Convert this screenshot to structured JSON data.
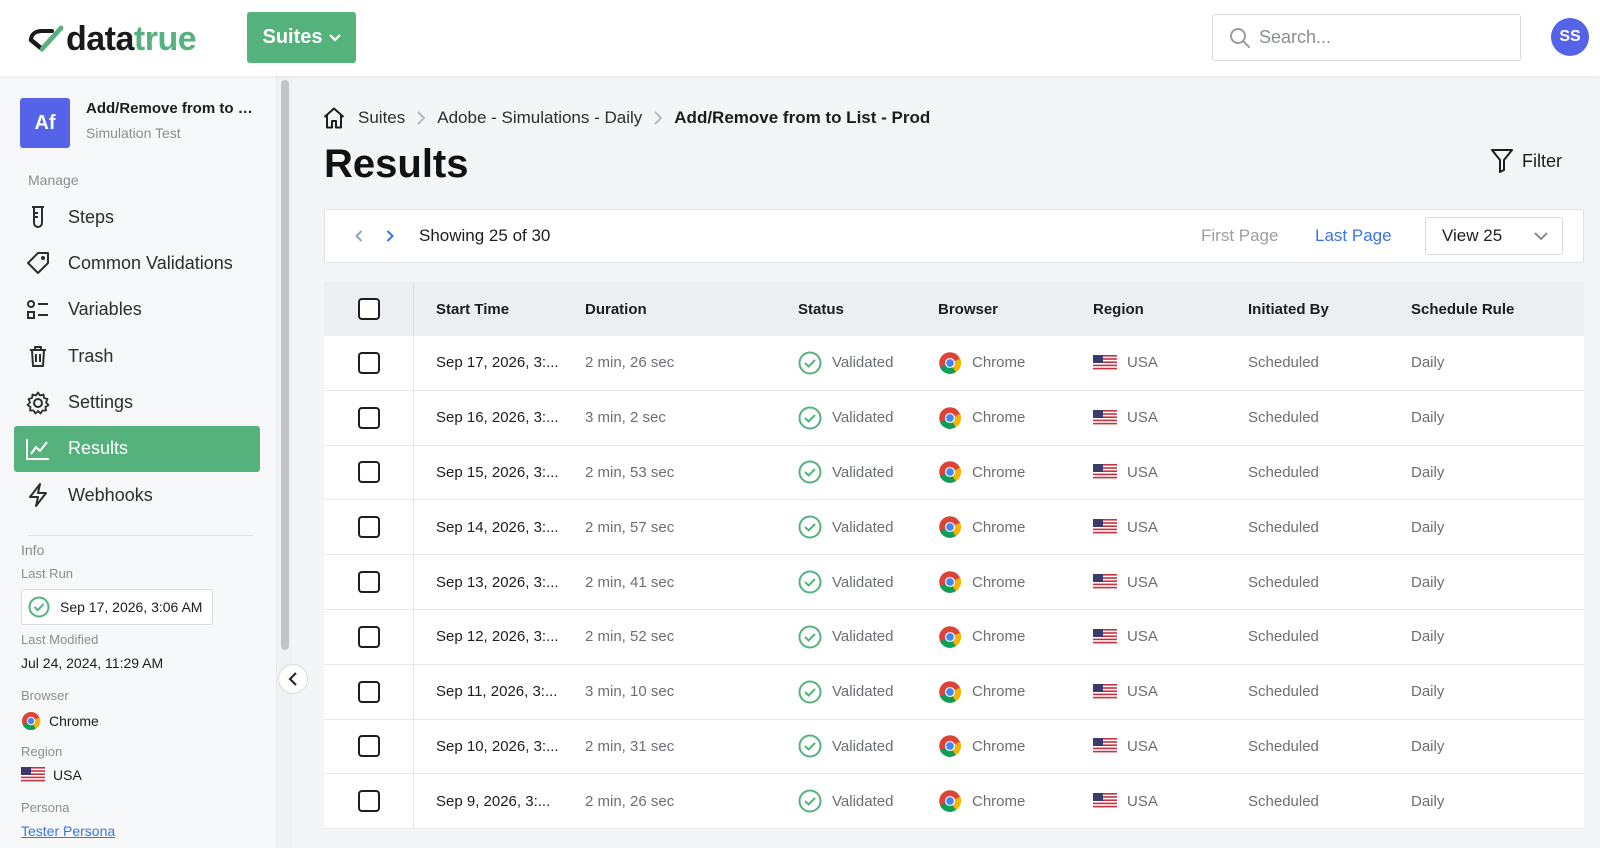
{
  "header": {
    "logo_prefix": "data",
    "logo_accent": "true",
    "suites_label": "Suites",
    "search_placeholder": "Search...",
    "user_initials": "SS"
  },
  "sidebar": {
    "suite_avatar": "Af",
    "suite_name": "Add/Remove from to List - Prod",
    "suite_type": "Simulation Test",
    "manage_label": "Manage",
    "items": [
      {
        "label": "Steps",
        "icon": "flask-icon"
      },
      {
        "label": "Common Validations",
        "icon": "tag-icon"
      },
      {
        "label": "Variables",
        "icon": "variables-icon"
      },
      {
        "label": "Trash",
        "icon": "trash-icon"
      },
      {
        "label": "Settings",
        "icon": "gear-icon"
      },
      {
        "label": "Results",
        "icon": "chart-line-icon",
        "active": true
      },
      {
        "label": "Webhooks",
        "icon": "bolt-icon"
      }
    ],
    "info_label": "Info",
    "last_run_label": "Last Run",
    "last_run_value": "Sep 17, 2026, 3:06 AM",
    "last_modified_label": "Last Modified",
    "last_modified_value": "Jul 24, 2024, 11:29 AM",
    "browser_label": "Browser",
    "browser_value": "Chrome",
    "region_label": "Region",
    "region_value": "USA",
    "persona_label": "Persona",
    "persona_value": "Tester Persona"
  },
  "breadcrumb": {
    "items": [
      "Suites",
      "Adobe - Simulations - Daily"
    ],
    "current": "Add/Remove from to List - Prod"
  },
  "page": {
    "title": "Results",
    "filter_label": "Filter"
  },
  "pager": {
    "showing": "Showing 25 of 30",
    "first_page": "First Page",
    "last_page": "Last Page",
    "view_value": "View 25"
  },
  "table": {
    "headers": [
      "Start Time",
      "Duration",
      "Status",
      "Browser",
      "Region",
      "Initiated By",
      "Schedule Rule"
    ],
    "rows": [
      {
        "start": "Sep 17, 2026, 3:...",
        "duration": "2 min, 26 sec",
        "status": "Validated",
        "browser": "Chrome",
        "region": "USA",
        "initiated": "Scheduled",
        "rule": "Daily"
      },
      {
        "start": "Sep 16, 2026, 3:...",
        "duration": "3 min, 2 sec",
        "status": "Validated",
        "browser": "Chrome",
        "region": "USA",
        "initiated": "Scheduled",
        "rule": "Daily"
      },
      {
        "start": "Sep 15, 2026, 3:...",
        "duration": "2 min, 53 sec",
        "status": "Validated",
        "browser": "Chrome",
        "region": "USA",
        "initiated": "Scheduled",
        "rule": "Daily"
      },
      {
        "start": "Sep 14, 2026, 3:...",
        "duration": "2 min, 57 sec",
        "status": "Validated",
        "browser": "Chrome",
        "region": "USA",
        "initiated": "Scheduled",
        "rule": "Daily"
      },
      {
        "start": "Sep 13, 2026, 3:...",
        "duration": "2 min, 41 sec",
        "status": "Validated",
        "browser": "Chrome",
        "region": "USA",
        "initiated": "Scheduled",
        "rule": "Daily"
      },
      {
        "start": "Sep 12, 2026, 3:...",
        "duration": "2 min, 52 sec",
        "status": "Validated",
        "browser": "Chrome",
        "region": "USA",
        "initiated": "Scheduled",
        "rule": "Daily"
      },
      {
        "start": "Sep 11, 2026, 3:...",
        "duration": "3 min, 10 sec",
        "status": "Validated",
        "browser": "Chrome",
        "region": "USA",
        "initiated": "Scheduled",
        "rule": "Daily"
      },
      {
        "start": "Sep 10, 2026, 3:...",
        "duration": "2 min, 31 sec",
        "status": "Validated",
        "browser": "Chrome",
        "region": "USA",
        "initiated": "Scheduled",
        "rule": "Daily"
      },
      {
        "start": "Sep 9, 2026, 3:...",
        "duration": "2 min, 26 sec",
        "status": "Validated",
        "browser": "Chrome",
        "region": "USA",
        "initiated": "Scheduled",
        "rule": "Daily"
      }
    ]
  },
  "colors": {
    "brand_green": "#55b27c",
    "avatar_blue": "#5463e8",
    "link_blue": "#3b73e6"
  }
}
